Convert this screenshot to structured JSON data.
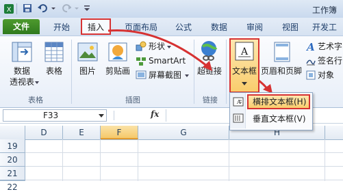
{
  "window": {
    "title": "工作簿"
  },
  "tabs": [
    "文件",
    "开始",
    "插入",
    "页面布局",
    "公式",
    "数据",
    "审阅",
    "视图",
    "开发工"
  ],
  "ribbon": {
    "groups": {
      "tables": {
        "label": "表格",
        "pivot_label_1": "数据",
        "pivot_label_2": "透视表",
        "table_label": "表格"
      },
      "illustrations": {
        "label": "插图",
        "picture": "图片",
        "clipart": "剪贴画",
        "shapes": "形状",
        "smartart": "SmartArt",
        "screenshot": "屏幕截图"
      },
      "links": {
        "label": "链接",
        "hyperlink": "超链接"
      },
      "text": {
        "textbox": "文本框",
        "header_footer": "页眉和页脚",
        "wordart": "艺术字",
        "signature": "签名行",
        "object": "对象"
      }
    }
  },
  "formula_bar": {
    "name_box": "F33",
    "fx": "fx"
  },
  "columns": [
    "D",
    "E",
    "F",
    "G",
    "H"
  ],
  "rows": [
    "19",
    "20",
    "21",
    "22"
  ],
  "textbox_menu": {
    "horizontal": "横排文本框(H)",
    "vertical": "垂直文本框(V)"
  },
  "colors": {
    "highlight_red": "#d63232",
    "file_tab": "#3c8a25",
    "selected_col": "#f5c96a"
  }
}
